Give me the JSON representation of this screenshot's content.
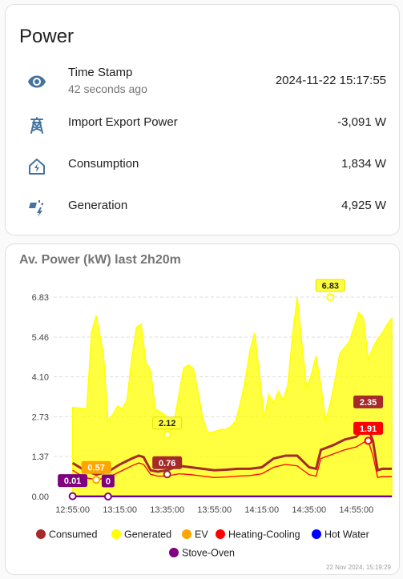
{
  "power_card": {
    "title": "Power",
    "rows": [
      {
        "icon": "eye-icon",
        "name": "Time Stamp",
        "secondary": "42 seconds ago",
        "value": "2024-11-22 15:17:55"
      },
      {
        "icon": "transmission-tower-icon",
        "name": "Import Export Power",
        "value": "-3,091 W"
      },
      {
        "icon": "home-lightning-icon",
        "name": "Consumption",
        "value": "1,834 W"
      },
      {
        "icon": "solar-power-icon",
        "name": "Generation",
        "value": "4,925 W"
      }
    ]
  },
  "chart_card": {
    "title": "Av. Power (kW) last 2h20m",
    "footnote": "22 Nov 2024, 15:19:29"
  },
  "colors": {
    "consumed": "#a52a2a",
    "generated": "#ffff00",
    "ev": "#ffa500",
    "heating_cooling": "#ff0000",
    "hot_water": "#0000ff",
    "stove_oven": "#800080",
    "icon": "#44739e"
  },
  "chart_data": {
    "type": "area",
    "title": "Av. Power (kW) last 2h20m",
    "x_ticks": [
      "12:55:00",
      "13:15:00",
      "13:35:00",
      "13:55:00",
      "14:15:00",
      "14:35:00",
      "14:55:00"
    ],
    "y_ticks": [
      "0.00",
      "1.37",
      "2.73",
      "4.10",
      "5.46",
      "6.83"
    ],
    "ylim": [
      0,
      6.83
    ],
    "xlim_minutes_from_1255": [
      -8,
      137
    ],
    "grid": true,
    "legend_position": "bottom",
    "series": [
      {
        "name": "Generated",
        "type": "area",
        "x": [
          0,
          6,
          8,
          10,
          13,
          15,
          17,
          19,
          21,
          23,
          25,
          27,
          29,
          31,
          33,
          35,
          37,
          39,
          41,
          43,
          45,
          47,
          49,
          51,
          53,
          55,
          57,
          59,
          61,
          63,
          65,
          67,
          69,
          71,
          73,
          75,
          77,
          79,
          81,
          83,
          85,
          87,
          89,
          91,
          93,
          95,
          97,
          99,
          101,
          103,
          105,
          107,
          109,
          111,
          113,
          115,
          117,
          119,
          121,
          123,
          125,
          127,
          129,
          131,
          133,
          135
        ],
        "y": [
          3.05,
          3.0,
          5.6,
          6.2,
          4.9,
          2.6,
          2.8,
          3.1,
          3.0,
          3.3,
          4.7,
          5.8,
          5.9,
          4.6,
          4.3,
          3.0,
          2.9,
          2.8,
          2.2,
          2.6,
          3.5,
          4.4,
          4.5,
          4.4,
          3.6,
          2.7,
          2.2,
          2.2,
          2.25,
          2.3,
          2.3,
          2.4,
          2.6,
          3.2,
          4.0,
          5.0,
          5.6,
          4.2,
          2.7,
          3.5,
          3.2,
          3.6,
          3.3,
          3.8,
          5.5,
          6.83,
          5.2,
          3.7,
          4.2,
          4.8,
          3.8,
          2.6,
          3.2,
          4.0,
          4.9,
          5.1,
          5.3,
          5.8,
          6.3,
          6.1,
          4.7,
          5.1,
          5.4,
          5.6,
          5.9,
          6.1
        ]
      },
      {
        "name": "Consumed",
        "type": "line",
        "x": [
          0,
          5,
          10,
          15,
          20,
          25,
          28,
          30,
          33,
          36,
          40,
          45,
          50,
          55,
          60,
          65,
          70,
          75,
          80,
          85,
          90,
          95,
          100,
          103,
          105,
          110,
          115,
          120,
          123,
          125,
          127,
          129,
          131,
          135
        ],
        "y": [
          1.15,
          0.9,
          0.75,
          0.85,
          1.1,
          1.3,
          1.4,
          1.35,
          0.9,
          0.85,
          0.9,
          1.05,
          1.0,
          0.95,
          0.9,
          0.92,
          0.95,
          0.95,
          1.0,
          1.3,
          1.4,
          1.4,
          1.0,
          0.95,
          1.6,
          1.75,
          1.95,
          2.05,
          2.3,
          2.35,
          1.9,
          0.9,
          0.95,
          0.95
        ]
      },
      {
        "name": "Heating-Cooling",
        "type": "line",
        "x": [
          0,
          5,
          10,
          15,
          20,
          25,
          28,
          30,
          33,
          36,
          40,
          45,
          50,
          55,
          60,
          65,
          70,
          75,
          80,
          85,
          90,
          95,
          100,
          103,
          105,
          110,
          115,
          120,
          123,
          125,
          127,
          129,
          131,
          135
        ],
        "y": [
          0.9,
          0.65,
          0.57,
          0.65,
          0.85,
          1.05,
          1.15,
          1.1,
          0.76,
          0.7,
          0.7,
          0.78,
          0.75,
          0.7,
          0.65,
          0.67,
          0.7,
          0.72,
          0.78,
          1.0,
          1.1,
          1.05,
          0.75,
          0.7,
          1.3,
          1.45,
          1.6,
          1.7,
          1.85,
          1.91,
          1.4,
          0.65,
          0.68,
          0.68
        ]
      },
      {
        "name": "EV",
        "type": "line",
        "x": [
          0,
          135
        ],
        "y": [
          0,
          0
        ]
      },
      {
        "name": "Hot Water",
        "type": "line",
        "x": [
          0,
          135
        ],
        "y": [
          0,
          0
        ]
      },
      {
        "name": "Stove-Oven",
        "type": "line",
        "x": [
          0,
          135
        ],
        "y": [
          0.01,
          0.01
        ]
      }
    ],
    "annotations": [
      {
        "text": "6.83",
        "x": 109,
        "y": 6.83,
        "series": "Generated"
      },
      {
        "text": "2.12",
        "x": 40,
        "y": 2.12,
        "series": "Generated"
      },
      {
        "text": "2.35",
        "x": 125,
        "y": 2.35,
        "series": "Consumed"
      },
      {
        "text": "1.91",
        "x": 125,
        "y": 1.91,
        "series": "Heating-Cooling"
      },
      {
        "text": "0.76",
        "x": 40,
        "y": 0.76,
        "series": "Consumed"
      },
      {
        "text": "0.57",
        "x": 10,
        "y": 0.57,
        "series": "EV"
      },
      {
        "text": "0.01",
        "x": 0,
        "y": 0.01,
        "series": "Stove-Oven"
      },
      {
        "text": "0",
        "x": 15,
        "y": 0,
        "series": "Stove-Oven"
      }
    ],
    "legend": [
      "Consumed",
      "Generated",
      "EV",
      "Heating-Cooling",
      "Hot Water",
      "Stove-Oven"
    ]
  }
}
